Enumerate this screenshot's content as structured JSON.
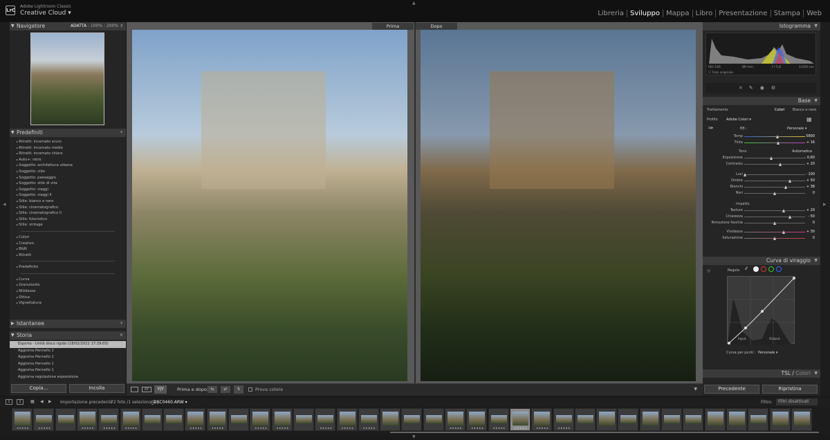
{
  "app": {
    "logo": "LrC",
    "name_line1": "Adobe Lightroom Classic",
    "name_line2": "Creative Cloud"
  },
  "modules": [
    {
      "label": "Libreria",
      "active": false
    },
    {
      "label": "Sviluppo",
      "active": true
    },
    {
      "label": "Mappa",
      "active": false
    },
    {
      "label": "Libro",
      "active": false
    },
    {
      "label": "Presentazione",
      "active": false
    },
    {
      "label": "Stampa",
      "active": false
    },
    {
      "label": "Web",
      "active": false
    }
  ],
  "navigator": {
    "title": "Navigatore",
    "zoom_options": [
      "ADATTA",
      "100%",
      "200%"
    ]
  },
  "presets": {
    "title": "Predefiniti",
    "items": [
      "Ritratti: incarnato scuro",
      "Ritratti: incarnato medio",
      "Ritratti: incarnato chiaro",
      "Auto+: retro",
      "Soggetto: architettura urbana",
      "Soggetto: cibo",
      "Soggetto: paesaggio",
      "Soggetto: stile di vita",
      "Soggetto: viaggi",
      "Soggetto: viaggi II",
      "Stile: bianco e nero",
      "Stile: cinematografico",
      "Stile: cinematografico II",
      "Stile: futuristico",
      "Stile: vintage"
    ],
    "groups": [
      "Colori",
      "Creativo",
      "B&N",
      "Ritratti"
    ],
    "groups2": [
      "Predefinito"
    ],
    "groups3": [
      "Curva",
      "Granulosità",
      "Nitidezza",
      "Ottica",
      "Vignettatura"
    ]
  },
  "snapshots": {
    "title": "Istantanee"
  },
  "history": {
    "title": "Storia",
    "items": [
      "Esporta - Unità disco rigido (18/02/2022 17:29:05)",
      "Aggiorna Pennello 1",
      "Aggiorna Pennello 1",
      "Aggiorna Pennello 1",
      "Aggiorna Pennello 1",
      "Aggiorna regolazione esposizione"
    ]
  },
  "left_buttons": {
    "copy": "Copia...",
    "paste": "Incolla"
  },
  "compare": {
    "before": "Prima",
    "after": "Dopo"
  },
  "toolbar": {
    "before_after_label": "Prima e dopo:",
    "soft_proof": "Prova colore"
  },
  "histogram": {
    "title": "Istogramma",
    "iso": "ISO 100",
    "focal": "89 mm",
    "aperture": "f / 5,6",
    "shutter": "1/320 sec",
    "original_photo": "Foto originale"
  },
  "basic": {
    "title": "Base",
    "treatment_label": "Trattamento",
    "treatment_color": "Colori",
    "treatment_bw": "Bianco e nero",
    "profile_label": "Profilo",
    "profile_value": "Adobe Colori",
    "wb_label": "BB :",
    "wb_value": "Personale",
    "temp": {
      "label": "Temp",
      "value": "5800",
      "pos": 0.55
    },
    "tint": {
      "label": "Tinta",
      "value": "+ 16",
      "pos": 0.56
    },
    "tone_label": "Tono",
    "auto_label": "Automatica",
    "tone": [
      {
        "label": "Esposizione",
        "value": "- 0,60",
        "pos": 0.45
      },
      {
        "label": "Contrasto",
        "value": "+ 20",
        "pos": 0.6
      }
    ],
    "tone2": [
      {
        "label": "Luci",
        "value": "- 100",
        "pos": 0.02
      },
      {
        "label": "Ombre",
        "value": "+ 50",
        "pos": 0.75
      },
      {
        "label": "Bianchi",
        "value": "+ 38",
        "pos": 0.69
      },
      {
        "label": "Neri",
        "value": "0",
        "pos": 0.5
      }
    ],
    "presence_label": "Impatto",
    "presence": [
      {
        "label": "Texture",
        "value": "+ 29",
        "pos": 0.65
      },
      {
        "label": "Chiarezza",
        "value": "- 50",
        "pos": 0.75
      },
      {
        "label": "Rimozione foschia",
        "value": "0",
        "pos": 0.5
      }
    ],
    "presence2": [
      {
        "label": "Vividezza",
        "value": "+ 30",
        "pos": 0.65
      },
      {
        "label": "Saturazione",
        "value": "0",
        "pos": 0.5
      }
    ]
  },
  "tone_curve": {
    "title": "Curva di viraggio",
    "region_label": "Regola",
    "input_label": "Input",
    "output_label": "Output",
    "point_curve_label": "Curva per punti :",
    "point_curve_value": "Personale"
  },
  "hsl": {
    "title": "TSL",
    "title2": "Colori"
  },
  "right_buttons": {
    "previous": "Precedente",
    "reset": "Ripristina"
  },
  "filmstrip": {
    "source": "Importazione precedente",
    "count": "72 foto /1 selezionata /",
    "filename": "_DSC0460.ARW",
    "filter_label": "Filtro:",
    "filter_value": "Filtri disattivati",
    "stars": "★★★★★"
  },
  "colors": {
    "accent": "#ffffff",
    "panel": "#2b2b2b",
    "header": "#3a3a3a"
  }
}
